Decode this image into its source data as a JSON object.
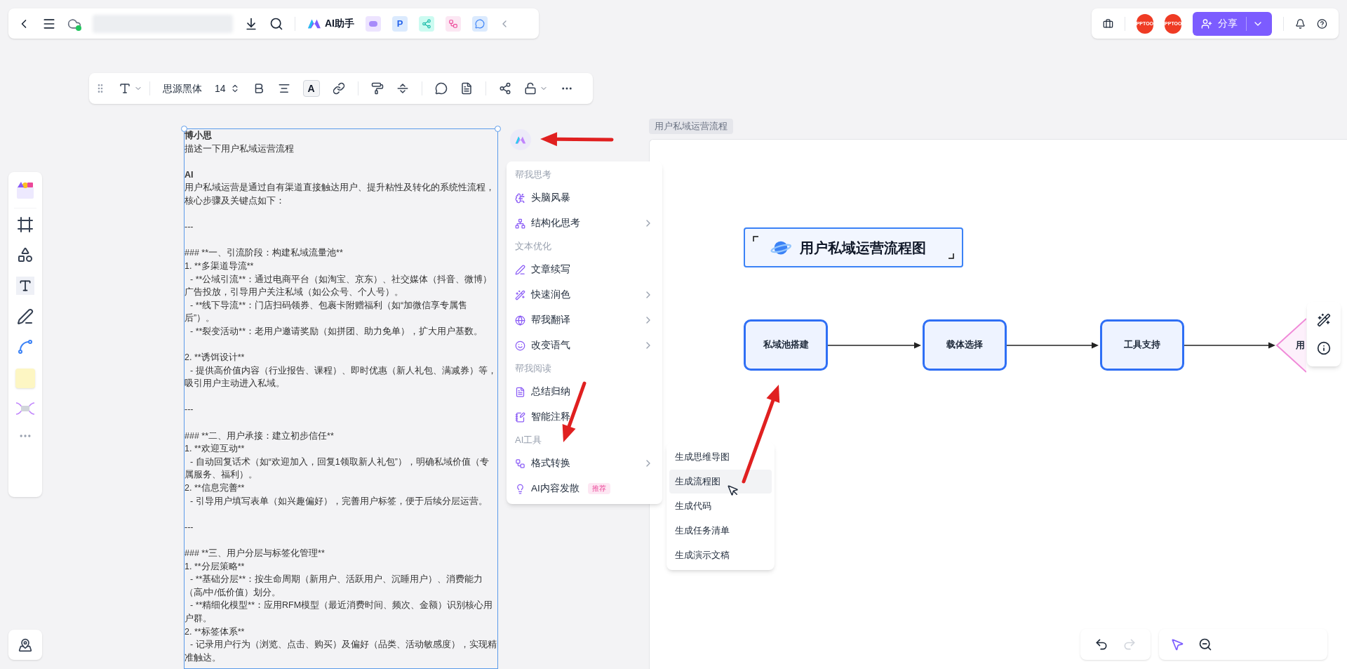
{
  "top_bar": {
    "ai_label": "AI助手",
    "app_letter": "P",
    "avatars": [
      "PPTOO",
      "PPTOO"
    ],
    "share_label": "分享"
  },
  "format_toolbar": {
    "font": "思源黑体",
    "size": "14",
    "color_glyph": "A"
  },
  "text_panel": {
    "paragraphs": [
      {
        "text": "博小思",
        "bold": true,
        "indent": false,
        "space_before": false
      },
      {
        "text": "描述一下用户私域运营流程",
        "bold": false,
        "indent": false,
        "space_before": false
      },
      {
        "text": "AI",
        "bold": true,
        "indent": false,
        "space_before": true
      },
      {
        "text": "用户私域运营是通过自有渠道直接触达用户、提升粘性及转化的系统性流程，核心步骤及关键点如下：",
        "bold": false,
        "indent": false,
        "space_before": false
      },
      {
        "text": "---",
        "bold": false,
        "indent": false,
        "space_before": true
      },
      {
        "text": "### **一、引流阶段：构建私域流量池**",
        "bold": false,
        "indent": false,
        "space_before": true
      },
      {
        "text": "1. **多渠道导流**",
        "bold": false,
        "indent": false,
        "space_before": false
      },
      {
        "text": "- **公域引流**：通过电商平台（如淘宝、京东）、社交媒体（抖音、微博）广告投放，引导用户关注私域（如公众号、个人号）。",
        "bold": false,
        "indent": true,
        "space_before": false
      },
      {
        "text": "- **线下导流**：门店扫码领券、包裹卡附赠福利（如“加微信享专属售后”）。",
        "bold": false,
        "indent": true,
        "space_before": false
      },
      {
        "text": "- **裂变活动**：老用户邀请奖励（如拼团、助力免单），扩大用户基数。",
        "bold": false,
        "indent": true,
        "space_before": false
      },
      {
        "text": "2. **诱饵设计**",
        "bold": false,
        "indent": false,
        "space_before": true
      },
      {
        "text": "- 提供高价值内容（行业报告、课程）、即时优惠（新人礼包、满减券）等，吸引用户主动进入私域。",
        "bold": false,
        "indent": true,
        "space_before": false
      },
      {
        "text": "---",
        "bold": false,
        "indent": false,
        "space_before": true
      },
      {
        "text": "### **二、用户承接：建立初步信任**",
        "bold": false,
        "indent": false,
        "space_before": true
      },
      {
        "text": "1. **欢迎互动**",
        "bold": false,
        "indent": false,
        "space_before": false
      },
      {
        "text": "- 自动回复话术（如“欢迎加入，回复1领取新人礼包”），明确私域价值（专属服务、福利）。",
        "bold": false,
        "indent": true,
        "space_before": false
      },
      {
        "text": "2. **信息完善**",
        "bold": false,
        "indent": false,
        "space_before": false
      },
      {
        "text": "- 引导用户填写表单（如兴趣偏好），完善用户标签，便于后续分层运营。",
        "bold": false,
        "indent": true,
        "space_before": false
      },
      {
        "text": "---",
        "bold": false,
        "indent": false,
        "space_before": true
      },
      {
        "text": "### **三、用户分层与标签化管理**",
        "bold": false,
        "indent": false,
        "space_before": true
      },
      {
        "text": "1. **分层策略**",
        "bold": false,
        "indent": false,
        "space_before": false
      },
      {
        "text": "- **基础分层**：按生命周期（新用户、活跃用户、沉睡用户）、消费能力（高/中/低价值）划分。",
        "bold": false,
        "indent": true,
        "space_before": false
      },
      {
        "text": "- **精细化模型**：应用RFM模型（最近消费时间、频次、金额）识别核心用户群。",
        "bold": false,
        "indent": true,
        "space_before": false
      },
      {
        "text": "2. **标签体系**",
        "bold": false,
        "indent": false,
        "space_before": false
      },
      {
        "text": "- 记录用户行为（浏览、点击、购买）及偏好（品类、活动敏感度），实现精准触达。",
        "bold": false,
        "indent": true,
        "space_before": false
      }
    ]
  },
  "ai_menu": {
    "sections": [
      {
        "title": "帮我思考",
        "items": [
          {
            "label": "头脑风暴",
            "submenu": false
          },
          {
            "label": "结构化思考",
            "submenu": true
          }
        ]
      },
      {
        "title": "文本优化",
        "items": [
          {
            "label": "文章续写",
            "submenu": false
          },
          {
            "label": "快速润色",
            "submenu": true
          },
          {
            "label": "帮我翻译",
            "submenu": true
          },
          {
            "label": "改变语气",
            "submenu": true
          }
        ]
      },
      {
        "title": "帮我阅读",
        "items": [
          {
            "label": "总结归纳",
            "submenu": false
          },
          {
            "label": "智能注释",
            "submenu": false
          }
        ]
      },
      {
        "title": "AI工具",
        "items": [
          {
            "label": "格式转换",
            "submenu": true
          },
          {
            "label": "AI内容发散",
            "submenu": false,
            "badge": "推荐"
          }
        ]
      }
    ]
  },
  "submenu": {
    "items": [
      {
        "label": "生成思维导图",
        "selected": false
      },
      {
        "label": "生成流程图",
        "selected": true
      },
      {
        "label": "生成代码",
        "selected": false
      },
      {
        "label": "生成任务清单",
        "selected": false
      },
      {
        "label": "生成演示文稿",
        "selected": false
      }
    ]
  },
  "canvas": {
    "frame_label": "用户私域运营流程",
    "title": "用户私域运营流程图",
    "nodes": [
      {
        "label": "私域池搭建",
        "kind": "process"
      },
      {
        "label": "载体选择",
        "kind": "process"
      },
      {
        "label": "工具支持",
        "kind": "process"
      },
      {
        "label": "用",
        "kind": "decision"
      }
    ]
  }
}
